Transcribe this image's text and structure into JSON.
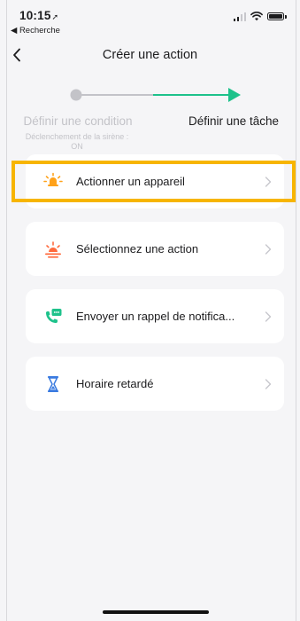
{
  "status_bar": {
    "time": "10:15",
    "location_glyph": "➚",
    "back_app": "◀ Recherche"
  },
  "nav": {
    "title": "Créer une action",
    "back_icon": "chevron-left-icon"
  },
  "stepper": {
    "step1_label": "Définir une condition",
    "step1_sub": "Déclenchement de la sirène : ON",
    "step2_label": "Définir une tâche",
    "active_color": "#1ec28b",
    "inactive_color": "#c3c3c8"
  },
  "actions": [
    {
      "label": "Actionner un appareil",
      "icon": "light-bulb-icon",
      "color": "#ffa21a"
    },
    {
      "label": "Sélectionnez une action",
      "icon": "sunrise-icon",
      "color": "#ff6a3d"
    },
    {
      "label": "Envoyer un rappel de notifica...",
      "icon": "phone-message-icon",
      "color": "#1ec28b"
    },
    {
      "label": "Horaire retardé",
      "icon": "hourglass-icon",
      "color": "#3a7be0"
    }
  ],
  "highlight_color": "#f7b500"
}
